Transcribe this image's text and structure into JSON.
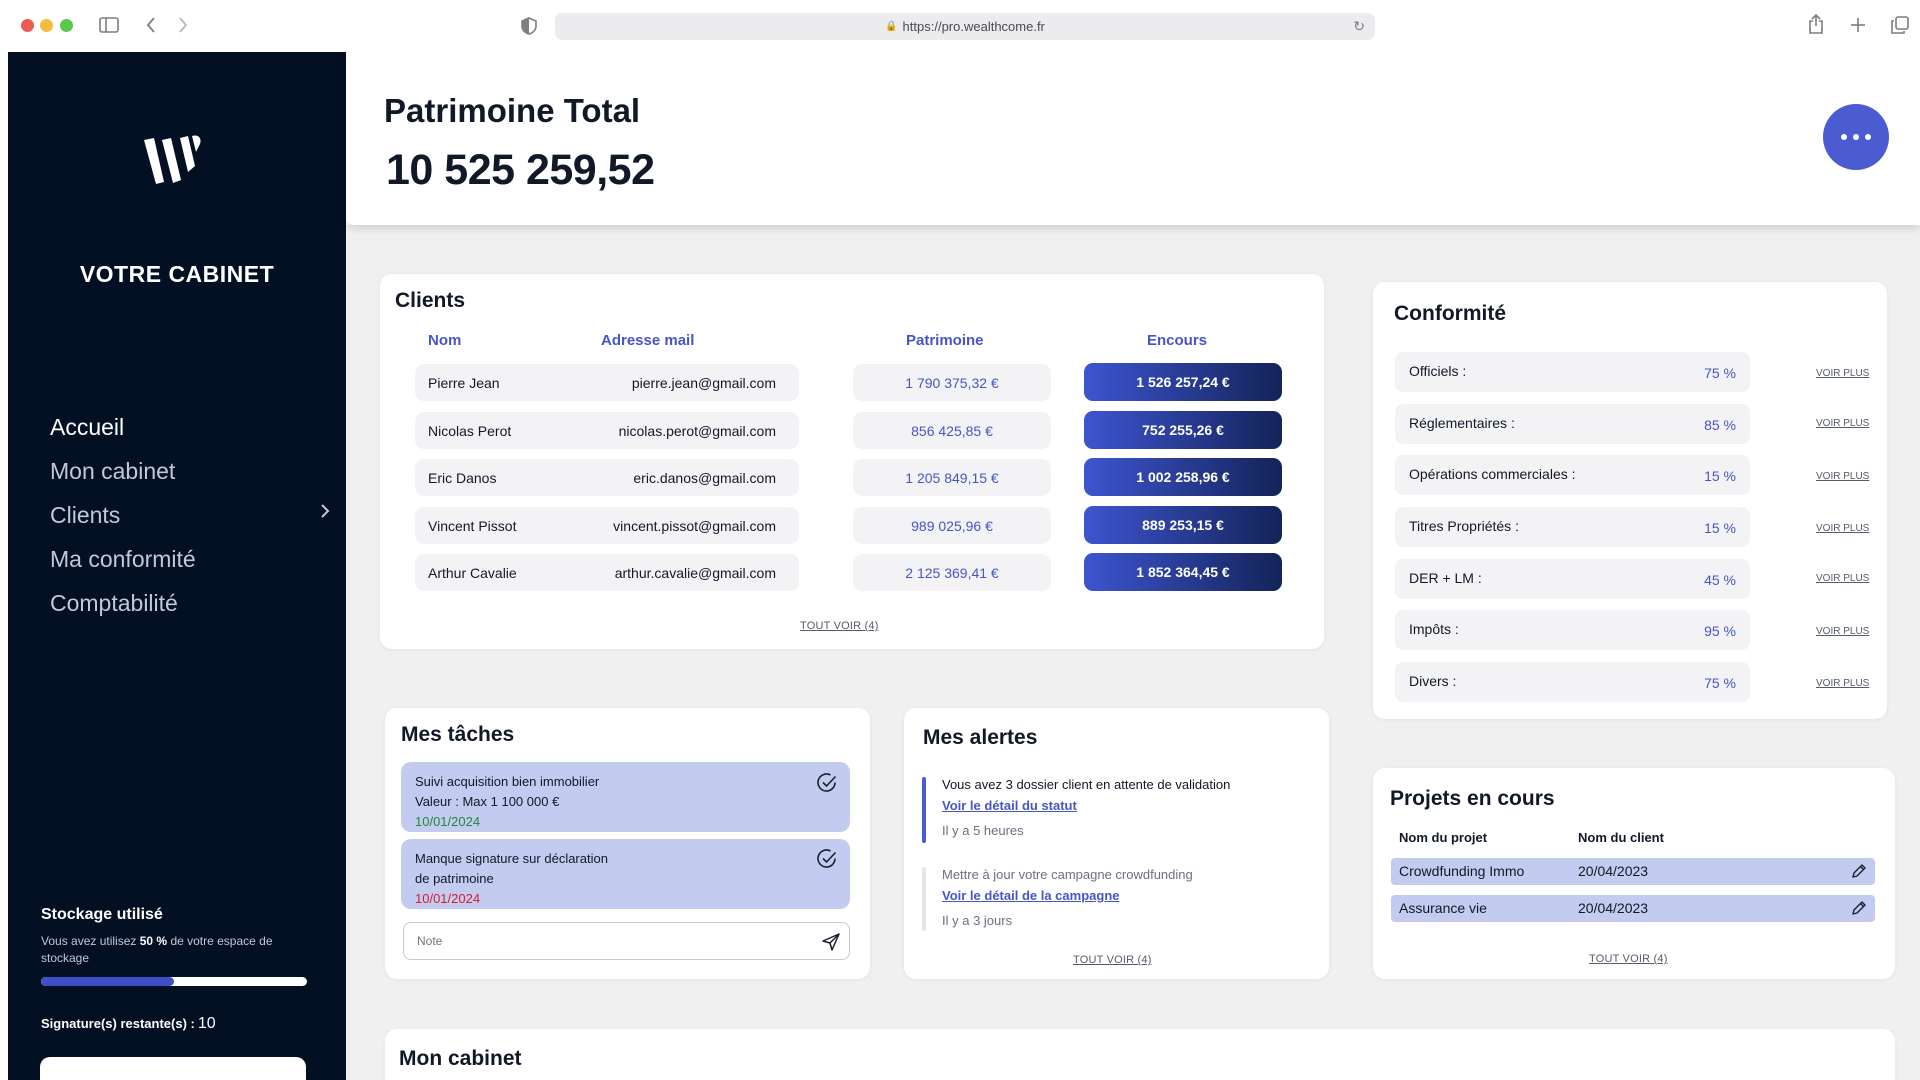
{
  "browser": {
    "url": "https://pro.wealthcome.fr"
  },
  "sidebar": {
    "cabinet_title": "VOTRE CABINET",
    "nav": [
      {
        "label": "Accueil"
      },
      {
        "label": "Mon cabinet"
      },
      {
        "label": "Clients"
      },
      {
        "label": "Ma conformité"
      },
      {
        "label": "Comptabilité"
      }
    ],
    "storage": {
      "title": "Stockage utilisé",
      "text_before": "Vous avez utilisez",
      "percent_label": "50 %",
      "text_after": "de votre espace de stockage",
      "percent_value": 0.5
    },
    "signature_label": "Signature(s) restante(s) :",
    "signature_count": "10"
  },
  "header": {
    "title": "Patrimoine Total",
    "value": "10 525 259,52"
  },
  "clients": {
    "title": "Clients",
    "headers": {
      "name": "Nom",
      "email": "Adresse mail",
      "patrimoine": "Patrimoine",
      "encours": "Encours"
    },
    "rows": [
      {
        "name": "Pierre Jean",
        "email": "pierre.jean@gmail.com",
        "patrimoine": "1 790 375,32 €",
        "encours": "1 526 257,24 €"
      },
      {
        "name": "Nicolas Perot",
        "email": "nicolas.perot@gmail.com",
        "patrimoine": "856 425,85 €",
        "encours": "752 255,26 €"
      },
      {
        "name": "Eric Danos",
        "email": "eric.danos@gmail.com",
        "patrimoine": "1 205 849,15 €",
        "encours": "1 002 258,96 €"
      },
      {
        "name": "Vincent Pissot",
        "email": "vincent.pissot@gmail.com",
        "patrimoine": "989 025,96 €",
        "encours": "889 253,15 €"
      },
      {
        "name": "Arthur Cavalie",
        "email": "arthur.cavalie@gmail.com",
        "patrimoine": "2 125 369,41 €",
        "encours": "1 852 364,45 €"
      }
    ],
    "see_all": "TOUT VOIR (4)"
  },
  "conformite": {
    "title": "Conformité",
    "link_label": "VOIR PLUS",
    "rows": [
      {
        "label": "Officiels :",
        "percent": "75 %"
      },
      {
        "label": "Réglementaires :",
        "percent": "85 %"
      },
      {
        "label": "Opérations commerciales :",
        "percent": "15 %"
      },
      {
        "label": "Titres Propriétés :",
        "percent": "15 %"
      },
      {
        "label": "DER + LM :",
        "percent": "45 %"
      },
      {
        "label": "Impôts :",
        "percent": "95 %"
      },
      {
        "label": "Divers :",
        "percent": "75 %"
      }
    ]
  },
  "tasks": {
    "title": "Mes tâches",
    "items": [
      {
        "line1": "Suivi acquisition bien immobilier",
        "line2": "Valeur : Max 1 100 000 €",
        "date": "10/01/2024",
        "date_color": "#1f8a3a"
      },
      {
        "line1": "Manque signature sur déclaration",
        "line2": "de patrimoine",
        "date": "10/01/2024",
        "date_color": "#d41e2c"
      }
    ],
    "note_placeholder": "Note"
  },
  "alerts": {
    "title": "Mes alertes",
    "items": [
      {
        "message": "Vous avez 3 dossier client en attente de validation",
        "link": "Voir le détail du statut",
        "time": "Il y a 5 heures"
      },
      {
        "message": "Mettre à jour votre campagne crowdfunding",
        "link": "Voir le détail de la campagne",
        "time": "Il y a 3 jours"
      }
    ],
    "see_all": "TOUT VOIR (4)"
  },
  "projects": {
    "title": "Projets en cours",
    "headers": {
      "project": "Nom du projet",
      "client": "Nom du client"
    },
    "rows": [
      {
        "project": "Crowdfunding Immo",
        "client": "20/04/2023"
      },
      {
        "project": "Assurance vie",
        "client": "20/04/2023"
      }
    ],
    "see_all": "TOUT VOIR (4)"
  },
  "mon_cabinet": {
    "title": "Mon cabinet"
  }
}
